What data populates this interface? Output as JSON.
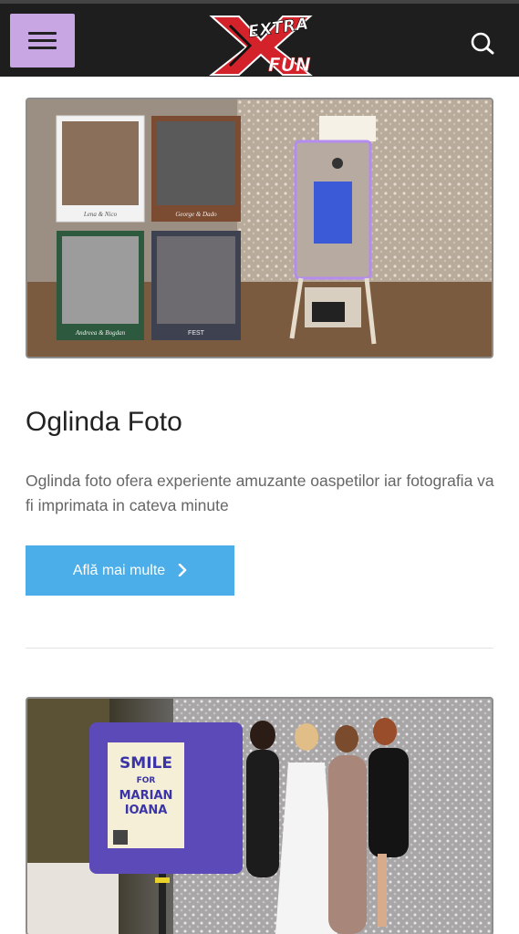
{
  "header": {
    "logo": {
      "top_text": "EXTRA",
      "bottom_text": "FUN",
      "big_letter": "X"
    },
    "menu_icon": "hamburger-menu-icon",
    "search_icon": "search-icon"
  },
  "colors": {
    "header_bg": "#1e1e1e",
    "menu_button": "#c7a6e3",
    "cta_button": "#4baee8",
    "logo_red": "#d4222a"
  },
  "cards": [
    {
      "title": "Oglinda Foto",
      "description": "Oglinda foto ofera experiente amuzante oaspetilor iar fotografia va fi imprimata in cateva minute",
      "button_label": "Află mai multe",
      "image": {
        "frame_names": [
          "Lena & Nico",
          "George & Dado",
          "Andreea & Bogdan",
          "FEST"
        ]
      }
    },
    {
      "image": {
        "sign_line1": "SMILE",
        "sign_line2": "FOR",
        "sign_line3": "MARIAN",
        "sign_line4": "IOANA"
      }
    }
  ]
}
